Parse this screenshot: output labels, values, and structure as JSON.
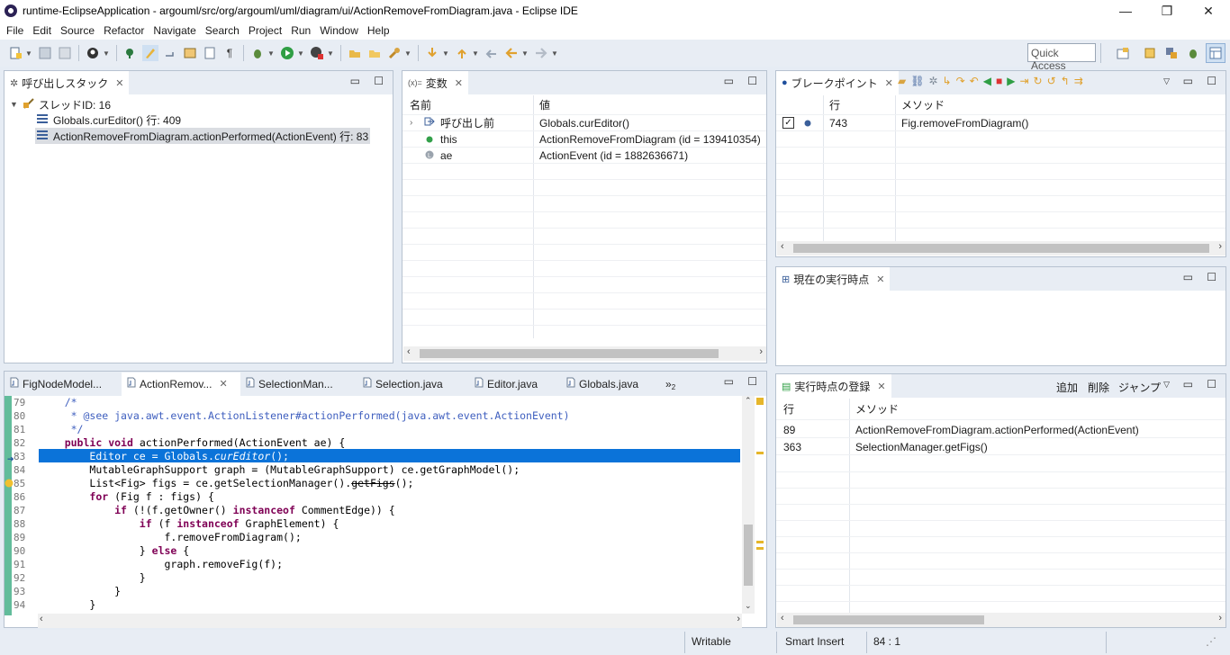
{
  "window": {
    "title": "runtime-EclipseApplication - argouml/src/org/argouml/uml/diagram/ui/ActionRemoveFromDiagram.java - Eclipse IDE",
    "minimize_glyph": "—",
    "restore_glyph": "❐",
    "close_glyph": "✕"
  },
  "menubar": {
    "items": [
      "File",
      "Edit",
      "Source",
      "Refactor",
      "Navigate",
      "Search",
      "Project",
      "Run",
      "Window",
      "Help"
    ]
  },
  "toolbar": {
    "quick_access_placeholder": "Quick Access"
  },
  "callstack": {
    "tab_label": "呼び出しスタック",
    "thread_label": "スレッドID: 16",
    "frames": [
      "Globals.curEditor() 行: 409",
      "ActionRemoveFromDiagram.actionPerformed(ActionEvent) 行: 83"
    ]
  },
  "variables": {
    "tab_label": "変数",
    "tab_prefix": "(x)=",
    "col_name": "名前",
    "col_value": "値",
    "rows": [
      {
        "name": "呼び出し前",
        "value": "Globals.curEditor()"
      },
      {
        "name": "this",
        "value": "ActionRemoveFromDiagram (id = 139410354)"
      },
      {
        "name": "ae",
        "value": "ActionEvent (id = 1882636671)"
      }
    ]
  },
  "breakpoints": {
    "tab_label": "ブレークポイント",
    "col_line": "行",
    "col_method": "メソッド",
    "rows": [
      {
        "line": "743",
        "method": "Fig.removeFromDiagram()",
        "checked": true
      }
    ]
  },
  "current_point": {
    "tab_label": "現在の実行時点"
  },
  "exec_registry": {
    "tab_label": "実行時点の登録",
    "add_label": "追加",
    "delete_label": "削除",
    "jump_label": "ジャンプ",
    "col_line": "行",
    "col_method": "メソッド",
    "rows": [
      {
        "line": "89",
        "method": "ActionRemoveFromDiagram.actionPerformed(ActionEvent)"
      },
      {
        "line": "363",
        "method": "SelectionManager.getFigs()"
      }
    ]
  },
  "editor": {
    "tabs": [
      {
        "label": "FigNodeModel..."
      },
      {
        "label": "ActionRemov..."
      },
      {
        "label": "SelectionMan..."
      },
      {
        "label": "Selection.java"
      },
      {
        "label": "Editor.java"
      },
      {
        "label": "Globals.java"
      }
    ],
    "overflow_label": "»",
    "overflow_count": "2",
    "line_numbers": [
      "79",
      "80",
      "81",
      "82",
      "83",
      "84",
      "85",
      "86",
      "87",
      "88",
      "89",
      "90",
      "91",
      "92",
      "93",
      "94"
    ],
    "lines": [
      {
        "indent": "    ",
        "parts": [
          [
            "cm",
            "/*"
          ]
        ]
      },
      {
        "indent": "     ",
        "parts": [
          [
            "cm",
            "* @see java.awt.event.ActionListener#actionPerformed(java.awt.event.ActionEvent)"
          ]
        ]
      },
      {
        "indent": "     ",
        "parts": [
          [
            "cm",
            "*/"
          ]
        ]
      },
      {
        "indent": "    ",
        "parts": [
          [
            "kw",
            "public"
          ],
          [
            "",
            " "
          ],
          [
            "kw",
            "void"
          ],
          [
            "",
            " actionPerformed(ActionEvent ae) {"
          ]
        ]
      },
      {
        "indent": "        ",
        "parts": [
          [
            "",
            "Editor ce = Globals."
          ],
          [
            "it",
            "curEditor"
          ],
          [
            "",
            "();"
          ]
        ]
      },
      {
        "indent": "        ",
        "parts": [
          [
            "",
            "MutableGraphSupport graph = (MutableGraphSupport) ce.getGraphModel();"
          ]
        ]
      },
      {
        "indent": "        ",
        "parts": [
          [
            "",
            "List<Fig> figs = ce.getSelectionManager()."
          ],
          [
            "st",
            "getFigs"
          ],
          [
            "",
            "();"
          ]
        ]
      },
      {
        "indent": "        ",
        "parts": [
          [
            "kw",
            "for"
          ],
          [
            "",
            " (Fig f : figs) {"
          ]
        ]
      },
      {
        "indent": "            ",
        "parts": [
          [
            "kw",
            "if"
          ],
          [
            "",
            " (!(f.getOwner() "
          ],
          [
            "kw",
            "instanceof"
          ],
          [
            "",
            " CommentEdge)) {"
          ]
        ]
      },
      {
        "indent": "                ",
        "parts": [
          [
            "kw",
            "if"
          ],
          [
            "",
            " (f "
          ],
          [
            "kw",
            "instanceof"
          ],
          [
            "",
            " GraphElement) {"
          ]
        ]
      },
      {
        "indent": "                    ",
        "parts": [
          [
            "",
            "f.removeFromDiagram();"
          ]
        ]
      },
      {
        "indent": "                ",
        "parts": [
          [
            "",
            "} "
          ],
          [
            "kw",
            "else"
          ],
          [
            "",
            " {"
          ]
        ]
      },
      {
        "indent": "                    ",
        "parts": [
          [
            "",
            "graph.removeFig(f);"
          ]
        ]
      },
      {
        "indent": "                ",
        "parts": [
          [
            "",
            "}"
          ]
        ]
      },
      {
        "indent": "            ",
        "parts": [
          [
            "",
            "}"
          ]
        ]
      },
      {
        "indent": "        ",
        "parts": [
          [
            "",
            "}"
          ]
        ]
      }
    ],
    "highlight_line_index": 4
  },
  "statusbar": {
    "writable": "Writable",
    "insert_mode": "Smart Insert",
    "position": "84 : 1"
  },
  "colors": {
    "highlight": "#0b73d9",
    "keyword": "#7f0055",
    "comment": "#3f5fbf",
    "gutter": "#2ea67a"
  }
}
